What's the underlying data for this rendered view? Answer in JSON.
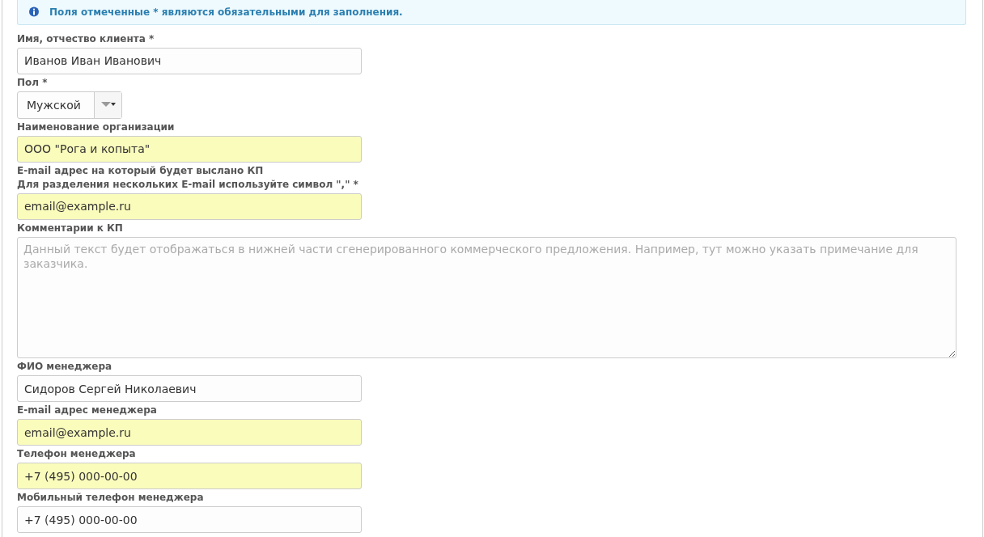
{
  "notice": {
    "text": "Поля отмеченные * являются обязательными для заполнения."
  },
  "fields": [
    {
      "kind": "text",
      "label_lines": [
        "Имя, отчество клиента *"
      ],
      "value": "Иванов Иван Иванович",
      "autofilled": false
    },
    {
      "kind": "select",
      "label_lines": [
        "Пол *"
      ],
      "value": "Мужской",
      "autofilled": false
    },
    {
      "kind": "text",
      "label_lines": [
        "Наименование организации"
      ],
      "value": "ООО \"Рога и копыта\"",
      "autofilled": true
    },
    {
      "kind": "text",
      "label_lines": [
        "E-mail адрес на который будет выслано КП",
        "Для разделения нескольких E-mail используйте символ \",\" *"
      ],
      "value": "email@example.ru",
      "autofilled": true
    },
    {
      "kind": "textarea",
      "label_lines": [
        "Комментарии к КП"
      ],
      "placeholder": "Данный текст будет отображаться в нижней части сгенерированного коммерческого предложения. Например, тут можно указать примечание для заказчика.",
      "autofilled": false
    },
    {
      "kind": "text",
      "label_lines": [
        "ФИО менеджера"
      ],
      "value": "Сидоров Сергей Николаевич",
      "autofilled": false
    },
    {
      "kind": "text",
      "label_lines": [
        "E-mail адрес менеджера"
      ],
      "value": "email@example.ru",
      "autofilled": true
    },
    {
      "kind": "text",
      "label_lines": [
        "Телефон менеджера"
      ],
      "value": "+7 (495) 000-00-00",
      "autofilled": true
    },
    {
      "kind": "text",
      "label_lines": [
        "Мобильный телефон менеджера"
      ],
      "value": "+7 (495) 000-00-00",
      "autofilled": false
    }
  ]
}
